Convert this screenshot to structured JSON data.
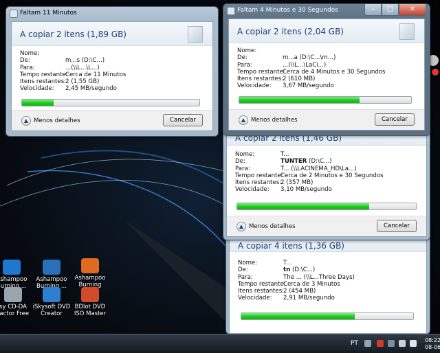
{
  "desktop_icons": [
    {
      "label": "Ashampoo Burning ...",
      "icon": "ashampoo-burning-icon",
      "color": "#1e78d2"
    },
    {
      "label": "Ashampoo Burning ...",
      "icon": "ashampoo-burning-studio-icon",
      "color": "#2a6fb8"
    },
    {
      "label": "Ashampoo Burning Stu...",
      "icon": "ashampoo-burning-studio-2-icon",
      "color": "#e06a1e"
    },
    {
      "label": "sy CD-DA ractor Free",
      "icon": "cd-da-extractor-icon",
      "color": "#9aa4ad"
    },
    {
      "label": "iSkysoft DVD Creator",
      "icon": "iskysoft-dvd-creator-icon",
      "color": "#2f7fd0"
    },
    {
      "label": "BDlot DVD ISO Master",
      "icon": "bdlot-dvd-iso-master-icon",
      "color": "#d24a2a"
    }
  ],
  "labels": {
    "nome": "Nome:",
    "de": "De:",
    "para": "Para:",
    "tempo": "Tempo restante:",
    "itens": "Itens restantes:",
    "velocidade": "Velocidade:",
    "menos_detalhes": "Menos detalhes",
    "cancelar": "Cancelar"
  },
  "dialogs": [
    {
      "title": "Faltam 11 Minutos",
      "heading": "A copiar 2 itens (1,89 GB)",
      "nome": "",
      "de": "m...s (D:\\C...)",
      "para": "...(\\\\L...\\L...)",
      "tempo": "Cerca de 11 Minutos",
      "itens": "2 (1,55 GB)",
      "velocidade": "2,45 MB/segundo",
      "progress": 0.18
    },
    {
      "title": "Faltam 4 Minutos e 30 Segundos",
      "heading": "A copiar 2 itens (2,04 GB)",
      "nome": "",
      "de": "m...a (D:\\C...\\m...)",
      "para": "...(\\\\L...\\LaCi...)",
      "tempo": "Cerca de 4 Minutos e 30 Segundos",
      "itens": "2 (610 MB)",
      "velocidade": "3,67 MB/segundo",
      "progress": 0.7
    },
    {
      "title": "",
      "heading": "A copiar 2 itens (1,46 GB)",
      "nome": "T...",
      "de_bold": "TUNTER",
      "de": " (D:\\C...)",
      "para": "T... (\\\\LACINEMA_HD\\La...)",
      "tempo": "Cerca de 2 Minutos e 30 Segundos",
      "itens": "2 (357 MB)",
      "velocidade": "3,10 MB/segundo",
      "progress": 0.74
    },
    {
      "title": "",
      "heading": "A copiar 4 itens (1,36 GB)",
      "nome": "T...",
      "de_bold": "tn",
      "de": " (D:\\C...)",
      "para": "The ... (\\\\L...Three Days)",
      "tempo": "Cerca de 3 Minutos",
      "itens": "2 (454 MB)",
      "velocidade": "2,91 MB/segundo",
      "progress": 0.66
    }
  ],
  "taskbar": {
    "language": "PT",
    "time": "08:22",
    "date": "08-06-20"
  }
}
